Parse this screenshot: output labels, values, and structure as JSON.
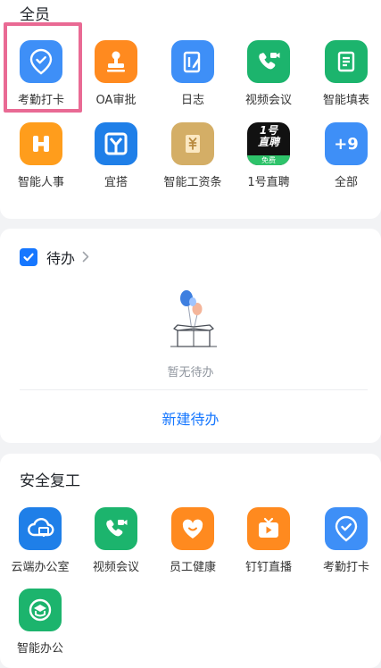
{
  "all_section": {
    "title": "全员",
    "apps": [
      {
        "label": "考勤打卡"
      },
      {
        "label": "OA审批"
      },
      {
        "label": "日志"
      },
      {
        "label": "视频会议"
      },
      {
        "label": "智能填表"
      },
      {
        "label": "智能人事"
      },
      {
        "label": "宜搭"
      },
      {
        "label": "智能工资条"
      },
      {
        "label": "1号直聘",
        "icon_text_top": "1号",
        "icon_text_mid": "直聘",
        "icon_badge": "免费"
      },
      {
        "label": "全部",
        "icon_text": "+9"
      }
    ]
  },
  "todo": {
    "title": "待办",
    "empty_text": "暂无待办",
    "new_label": "新建待办"
  },
  "safe_section": {
    "title": "安全复工",
    "apps": [
      {
        "label": "云端办公室"
      },
      {
        "label": "视频会议"
      },
      {
        "label": "员工健康"
      },
      {
        "label": "钉钉直播"
      },
      {
        "label": "考勤打卡"
      },
      {
        "label": "智能办公"
      }
    ]
  },
  "colors": {
    "blue": "#3e8ff7",
    "orange": "#ff8a1f",
    "green": "#1cb46d",
    "gold": "#d4ae66",
    "black": "#111111",
    "highlight": "#e96a94",
    "link": "#1677ff"
  }
}
